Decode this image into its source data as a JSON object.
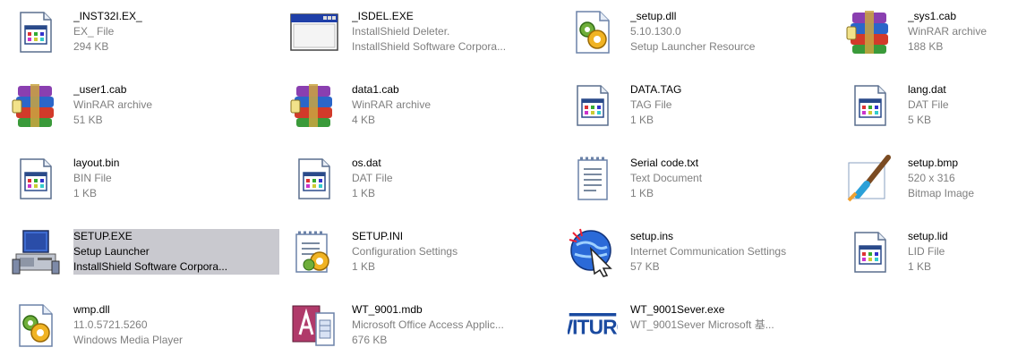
{
  "files": [
    {
      "name": "_INST32I.EX_",
      "type": "EX_ File",
      "detail": "294 KB",
      "icon": "generic-file-icon"
    },
    {
      "name": "_ISDEL.EXE",
      "type": "InstallShield Deleter.",
      "detail": "InstallShield Software Corpora...",
      "icon": "window-app-icon"
    },
    {
      "name": "_setup.dll",
      "type": "5.10.130.0",
      "detail": "Setup Launcher Resource",
      "icon": "dll-gears-icon"
    },
    {
      "name": "_sys1.cab",
      "type": "WinRAR archive",
      "detail": "188 KB",
      "icon": "winrar-archive-icon"
    },
    {
      "name": "_user1.cab",
      "type": "WinRAR archive",
      "detail": "51 KB",
      "icon": "winrar-archive-icon"
    },
    {
      "name": "data1.cab",
      "type": "WinRAR archive",
      "detail": "4 KB",
      "icon": "winrar-archive-icon"
    },
    {
      "name": "DATA.TAG",
      "type": "TAG File",
      "detail": "1 KB",
      "icon": "generic-file-icon"
    },
    {
      "name": "lang.dat",
      "type": "DAT File",
      "detail": "5 KB",
      "icon": "generic-file-icon"
    },
    {
      "name": "layout.bin",
      "type": "BIN File",
      "detail": "1 KB",
      "icon": "generic-file-icon"
    },
    {
      "name": "os.dat",
      "type": "DAT File",
      "detail": "1 KB",
      "icon": "generic-file-icon"
    },
    {
      "name": "Serial code.txt",
      "type": "Text Document",
      "detail": "1 KB",
      "icon": "text-document-icon"
    },
    {
      "name": "setup.bmp",
      "type": "520 x 316",
      "detail": "Bitmap Image",
      "icon": "paint-brush-icon"
    },
    {
      "name": "SETUP.EXE",
      "type": "Setup Launcher",
      "detail": "InstallShield Software Corpora...",
      "icon": "computer-setup-icon",
      "selected": true
    },
    {
      "name": "SETUP.INI",
      "type": "Configuration Settings",
      "detail": "1 KB",
      "icon": "config-settings-icon"
    },
    {
      "name": "setup.ins",
      "type": "Internet Communication Settings",
      "detail": "57 KB",
      "icon": "globe-cursor-icon"
    },
    {
      "name": "setup.lid",
      "type": "LID File",
      "detail": "1 KB",
      "icon": "generic-file-icon"
    },
    {
      "name": "wmp.dll",
      "type": "11.0.5721.5260",
      "detail": "Windows Media Player",
      "icon": "dll-gears-icon"
    },
    {
      "name": "WT_9001.mdb",
      "type": "Microsoft Office Access Applic...",
      "detail": "676 KB",
      "icon": "access-db-icon"
    },
    {
      "name": "WT_9001Sever.exe",
      "type": "WT_9001Sever Microsoft 基...",
      "detail": "",
      "icon": "witurg-logo-icon"
    }
  ]
}
